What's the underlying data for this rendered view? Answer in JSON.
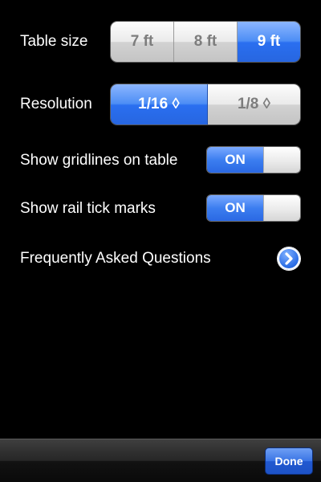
{
  "settings": {
    "table_size": {
      "label": "Table size",
      "options": [
        "7 ft",
        "8 ft",
        "9 ft"
      ],
      "selected": "9 ft"
    },
    "resolution": {
      "label": "Resolution",
      "options": [
        "1/16 ◊",
        "1/8 ◊"
      ],
      "selected": "1/16 ◊"
    },
    "gridlines": {
      "label": "Show gridlines on table",
      "state": "ON"
    },
    "rail_ticks": {
      "label": "Show rail tick marks",
      "state": "ON"
    },
    "faq": {
      "label": "Frequently Asked Questions",
      "icon": "chevron-right-circle-icon"
    }
  },
  "toolbar": {
    "done_label": "Done"
  },
  "colors": {
    "accent": "#2a6ff0",
    "background": "#000000"
  }
}
